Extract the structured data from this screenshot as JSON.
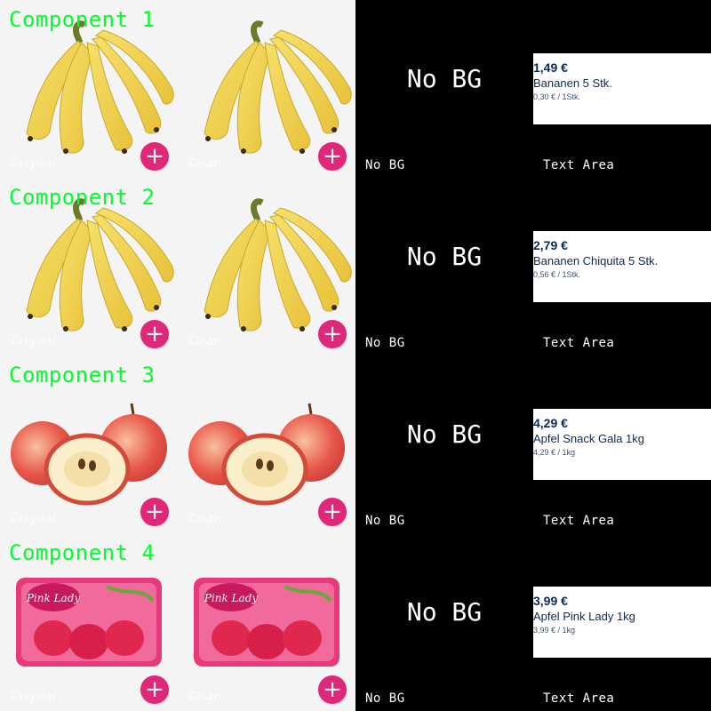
{
  "rows": [
    {
      "component": "Component 1",
      "original_label": "Original",
      "clean_label": "Clean",
      "nobg_big": "No BG",
      "nobg_small": "No BG",
      "textarea_label": "Text Area",
      "product_icon": "banana-bunch-icon",
      "price": "1,49 €",
      "name": "Bananen 5 Stk.",
      "unit_price": "0,30 € / 1Stk."
    },
    {
      "component": "Component 2",
      "original_label": "Original",
      "clean_label": "Clean",
      "nobg_big": "No BG",
      "nobg_small": "No BG",
      "textarea_label": "Text Area",
      "product_icon": "banana-bunch-icon",
      "price": "2,79 €",
      "name": "Bananen Chiquita 5 Stk.",
      "unit_price": "0,56 € / 1Stk."
    },
    {
      "component": "Component 3",
      "original_label": "Original",
      "clean_label": "Clean",
      "nobg_big": "No BG",
      "nobg_small": "No BG",
      "textarea_label": "Text Area",
      "product_icon": "apple-icon",
      "price": "4,29 €",
      "name": "Apfel Snack Gala 1kg",
      "unit_price": "4,29 € / 1kg"
    },
    {
      "component": "Component 4",
      "original_label": "Original",
      "clean_label": "Clean",
      "nobg_big": "No BG",
      "nobg_small": "No BG",
      "textarea_label": "Text Area",
      "product_icon": "pink-lady-box-icon",
      "price": "3,99 €",
      "name": "Apfel Pink Lady 1kg",
      "unit_price": "3,99 € / 1kg"
    }
  ],
  "plus_symbol": "+",
  "colors": {
    "component_label": "#00ff2a",
    "plus_button": "#e0287a",
    "price_text": "#0c2a52",
    "tile_background": "#f4f4f4"
  }
}
